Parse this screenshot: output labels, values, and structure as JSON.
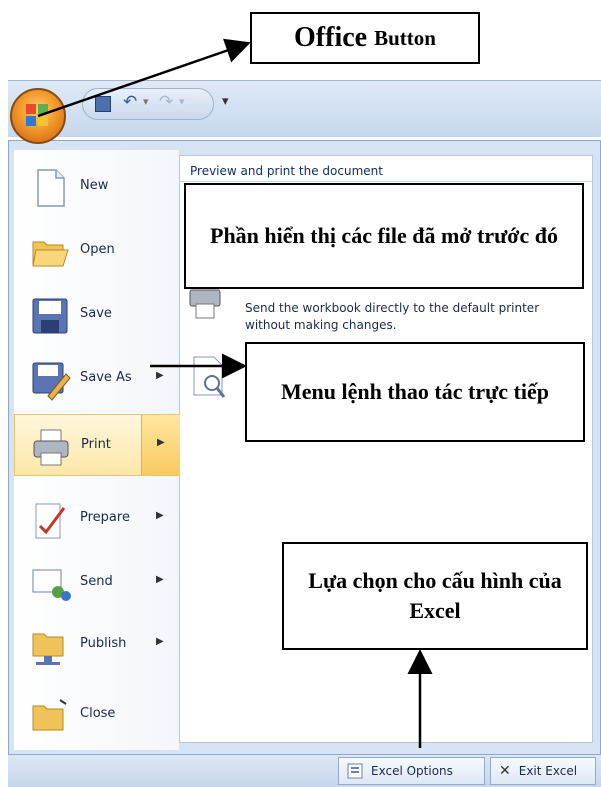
{
  "callouts": {
    "office_button": {
      "main": "Office",
      "suffix": "Button"
    },
    "recent_files": "Phần hiển thị các file đã mở trước đó",
    "direct_menu": "Menu lệnh thao tác trực tiếp",
    "excel_options": "Lựa chọn cho cấu hình của Excel"
  },
  "right_pane": {
    "header": "Preview and print the document",
    "print_desc": "Send the workbook directly to the default printer without making changes."
  },
  "menu": {
    "items": [
      {
        "label": "New",
        "icon": "new-document-icon",
        "has_arrow": false
      },
      {
        "label": "Open",
        "icon": "open-folder-icon",
        "has_arrow": false
      },
      {
        "label": "Save",
        "icon": "save-disk-icon",
        "has_arrow": false
      },
      {
        "label": "Save As",
        "icon": "save-as-icon",
        "has_arrow": true
      },
      {
        "label": "Print",
        "icon": "printer-icon",
        "has_arrow": true
      },
      {
        "label": "Prepare",
        "icon": "prepare-icon",
        "has_arrow": true
      },
      {
        "label": "Send",
        "icon": "send-icon",
        "has_arrow": true
      },
      {
        "label": "Publish",
        "icon": "publish-icon",
        "has_arrow": true
      },
      {
        "label": "Close",
        "icon": "close-folder-icon",
        "has_arrow": false
      }
    ],
    "active_index": 4,
    "arrow_glyph": "▶"
  },
  "footer": {
    "options_label": "Excel Options",
    "exit_label": "Exit Excel",
    "exit_glyph": "✕"
  },
  "qat": {
    "dropdown_glyph": "▾"
  },
  "colors": {
    "accent": "#f39a2a",
    "frame": "#d6e3f3",
    "highlight": "#fde6a8"
  }
}
